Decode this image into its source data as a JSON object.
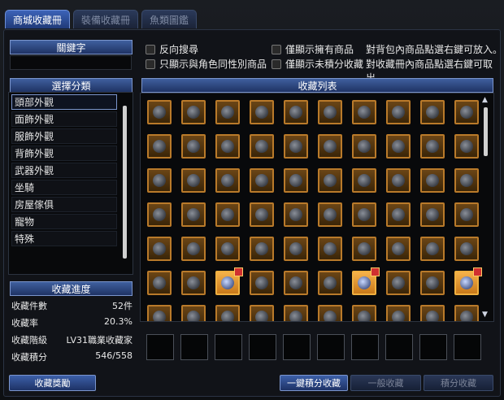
{
  "tabs": [
    {
      "label": "商城收藏冊",
      "active": true
    },
    {
      "label": "裝備收藏冊",
      "active": false
    },
    {
      "label": "魚類圖鑑",
      "active": false
    }
  ],
  "keyword": {
    "header": "關鍵字",
    "value": ""
  },
  "options": {
    "reverse": "反向搜尋",
    "same_gender": "只顯示與角色同性別商品",
    "owned_only": "僅顯示擁有商品",
    "unscored_only": "僅顯示未積分收藏"
  },
  "hints": {
    "line1": "對背包內商品點選右鍵可放入。",
    "line2": "對收藏冊內商品點選右鍵可取出。"
  },
  "category": {
    "header": "選擇分類",
    "items": [
      "頭部外觀",
      "面飾外觀",
      "服飾外觀",
      "背飾外觀",
      "武器外觀",
      "坐騎",
      "房屋傢俱",
      "寵物",
      "特殊"
    ],
    "selected": 0
  },
  "progress": {
    "header": "收藏進度",
    "rows": [
      {
        "label": "收藏件數",
        "value": "52件"
      },
      {
        "label": "收藏率",
        "value": "20.3%"
      },
      {
        "label": "收藏階級",
        "value": "LV31職業收藏家"
      },
      {
        "label": "收藏積分",
        "value": "546/558"
      }
    ]
  },
  "collection": {
    "header": "收藏列表",
    "rows": 7,
    "cols": 10,
    "highlighted": [
      [
        5,
        2
      ],
      [
        5,
        6
      ],
      [
        5,
        9
      ]
    ],
    "gifts": [
      [
        5,
        2
      ],
      [
        5,
        6
      ],
      [
        5,
        9
      ]
    ]
  },
  "slots_count": 10,
  "buttons": {
    "reward": "收藏獎勵",
    "one_click": "一鍵積分收藏",
    "normal": "一般收藏",
    "score": "積分收藏"
  },
  "icons": {
    "scroll_up": "triangle-up-icon",
    "scroll_down": "triangle-down-icon"
  }
}
